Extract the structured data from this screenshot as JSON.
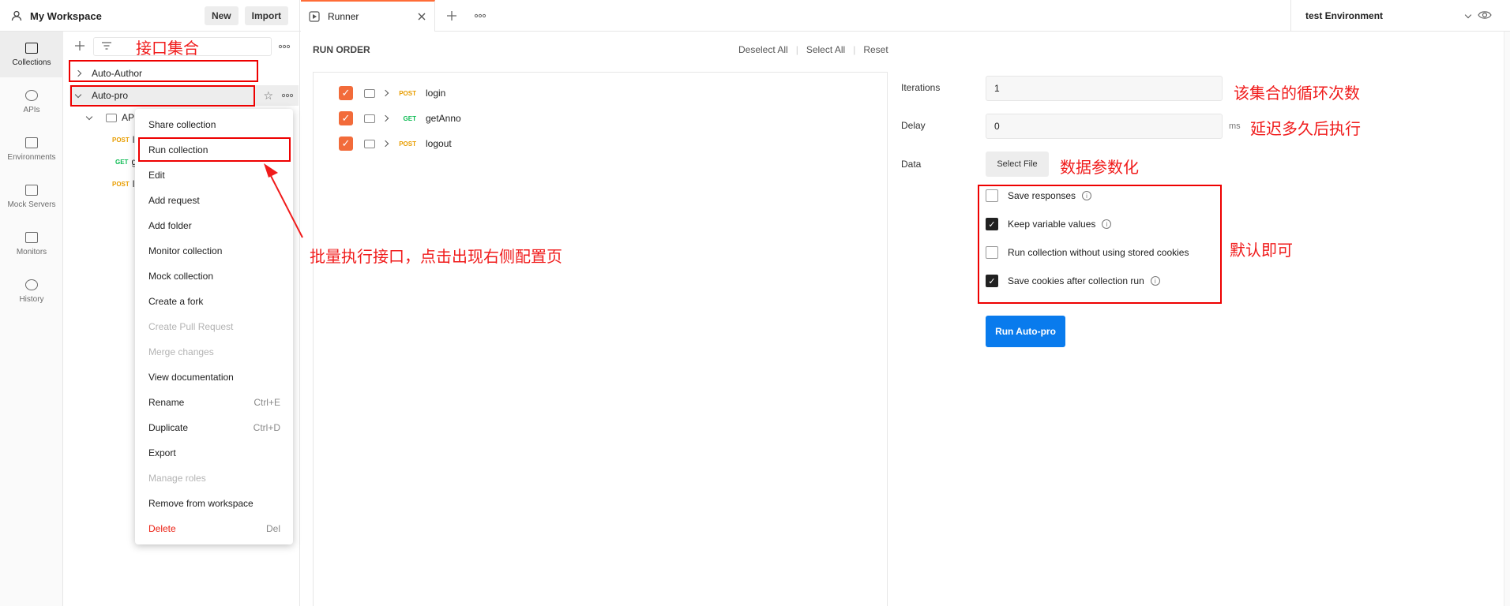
{
  "header": {
    "workspace": "My Workspace",
    "new_label": "New",
    "import_label": "Import",
    "tab_label": "Runner",
    "environment": "test Environment"
  },
  "nav": {
    "items": [
      {
        "label": "Collections",
        "icon": "collections-icon"
      },
      {
        "label": "APIs",
        "icon": "apis-icon"
      },
      {
        "label": "Environments",
        "icon": "environments-icon"
      },
      {
        "label": "Mock Servers",
        "icon": "mock-servers-icon"
      },
      {
        "label": "Monitors",
        "icon": "monitors-icon"
      },
      {
        "label": "History",
        "icon": "history-icon"
      }
    ]
  },
  "sidebar": {
    "collections": [
      "Auto-Author",
      "Auto-pro"
    ],
    "folder": "AP",
    "requests": [
      {
        "method": "POST",
        "name": "l"
      },
      {
        "method": "GET",
        "name": "g"
      },
      {
        "method": "POST",
        "name": "l"
      }
    ]
  },
  "menu": {
    "items": [
      {
        "label": "Share collection",
        "shortcut": ""
      },
      {
        "label": "Run collection",
        "shortcut": ""
      },
      {
        "label": "Edit",
        "shortcut": ""
      },
      {
        "label": "Add request",
        "shortcut": ""
      },
      {
        "label": "Add folder",
        "shortcut": ""
      },
      {
        "label": "Monitor collection",
        "shortcut": ""
      },
      {
        "label": "Mock collection",
        "shortcut": ""
      },
      {
        "label": "Create a fork",
        "shortcut": ""
      },
      {
        "label": "Create Pull Request",
        "shortcut": ""
      },
      {
        "label": "Merge changes",
        "shortcut": ""
      },
      {
        "label": "View documentation",
        "shortcut": ""
      },
      {
        "label": "Rename",
        "shortcut": "Ctrl+E"
      },
      {
        "label": "Duplicate",
        "shortcut": "Ctrl+D"
      },
      {
        "label": "Export",
        "shortcut": ""
      },
      {
        "label": "Manage roles",
        "shortcut": ""
      },
      {
        "label": "Remove from workspace",
        "shortcut": ""
      },
      {
        "label": "Delete",
        "shortcut": "Del"
      }
    ]
  },
  "runner": {
    "title": "RUN ORDER",
    "deselect_all": "Deselect All",
    "select_all": "Select All",
    "reset": "Reset",
    "requests": [
      {
        "method": "POST",
        "name": "login"
      },
      {
        "method": "GET",
        "name": "getAnno"
      },
      {
        "method": "POST",
        "name": "logout"
      }
    ],
    "iterations_label": "Iterations",
    "iterations_value": "1",
    "delay_label": "Delay",
    "delay_value": "0",
    "delay_unit": "ms",
    "data_label": "Data",
    "select_file": "Select File",
    "options": [
      {
        "label": "Save responses",
        "checked": false
      },
      {
        "label": "Keep variable values",
        "checked": true
      },
      {
        "label": "Run collection without using stored cookies",
        "checked": false
      },
      {
        "label": "Save cookies after collection run",
        "checked": true
      }
    ],
    "run_button": "Run Auto-pro"
  },
  "annotations": {
    "collections_note": "接口集合",
    "run_note": "批量执行接口，点击出现右侧配置页",
    "iterations_note": "该集合的循环次数",
    "delay_note": "延迟多久后执行",
    "data_note": "数据参数化",
    "options_note": "默认即可"
  },
  "colors": {
    "accent": "#ff6c37",
    "checkbox": "#f26b3a",
    "run_button": "#097bed",
    "annotation": "#f01b1b",
    "post": "#e89d00",
    "get": "#0cbb52",
    "delete": "#eb2013"
  }
}
